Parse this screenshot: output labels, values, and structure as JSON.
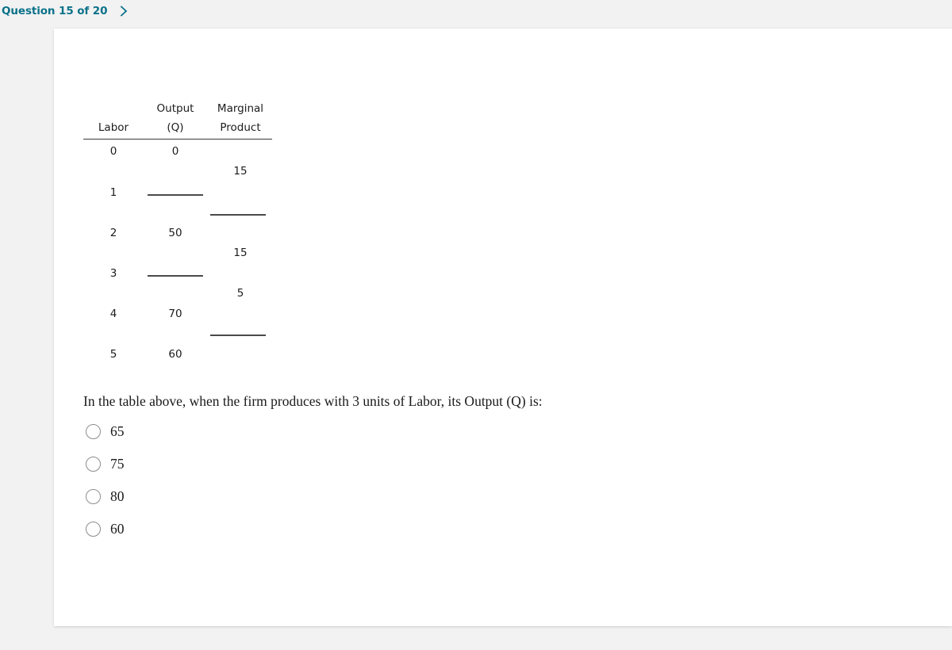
{
  "header": {
    "progress_label": "Question 15 of 20",
    "next_icon": "chevron-right-icon",
    "accent_color": "#0a7189"
  },
  "figure": {
    "columns": [
      {
        "id": "labor",
        "lines": [
          "Labor"
        ]
      },
      {
        "id": "output",
        "lines": [
          "Output",
          "(Q)"
        ]
      },
      {
        "id": "mp",
        "lines": [
          "Marginal",
          "Product"
        ]
      }
    ],
    "header_line1_output": "Output",
    "header_line1_mp": "Marginal",
    "header_labor": "Labor",
    "header_output": "(Q)",
    "header_mp": "Product",
    "rows": [
      {
        "labor": "0",
        "output": "0",
        "output_blank": false
      },
      {
        "labor": "1",
        "output": "",
        "output_blank": true
      },
      {
        "labor": "2",
        "output": "50",
        "output_blank": false
      },
      {
        "labor": "3",
        "output": "",
        "output_blank": true
      },
      {
        "labor": "4",
        "output": "70",
        "output_blank": false
      },
      {
        "labor": "5",
        "output": "60",
        "output_blank": false
      }
    ],
    "marginal_products": [
      {
        "between": "0-1",
        "value": "15",
        "blank": false
      },
      {
        "between": "1-2",
        "value": "",
        "blank": true
      },
      {
        "between": "2-3",
        "value": "15",
        "blank": false
      },
      {
        "between": "3-4",
        "value": "5",
        "blank": false
      },
      {
        "between": "4-5",
        "value": "",
        "blank": true
      }
    ]
  },
  "question": {
    "prompt": "In the table above, when the firm produces with 3 units of Labor, its Output (Q) is:",
    "options": [
      {
        "label": "65",
        "selected": false
      },
      {
        "label": "75",
        "selected": false
      },
      {
        "label": "80",
        "selected": false
      },
      {
        "label": "60",
        "selected": false
      }
    ]
  },
  "chart_data": {
    "type": "table",
    "title": "Labor / Output / Marginal Product table",
    "columns": [
      "Labor",
      "Output (Q)",
      "Marginal Product"
    ],
    "rows": [
      [
        "0",
        "0",
        ""
      ],
      [
        "",
        "",
        "15"
      ],
      [
        "1",
        "____",
        ""
      ],
      [
        "",
        "",
        "____"
      ],
      [
        "2",
        "50",
        ""
      ],
      [
        "",
        "",
        "15"
      ],
      [
        "3",
        "____",
        ""
      ],
      [
        "",
        "",
        "5"
      ],
      [
        "4",
        "70",
        ""
      ],
      [
        "",
        "",
        "____"
      ],
      [
        "5",
        "60",
        ""
      ]
    ]
  }
}
